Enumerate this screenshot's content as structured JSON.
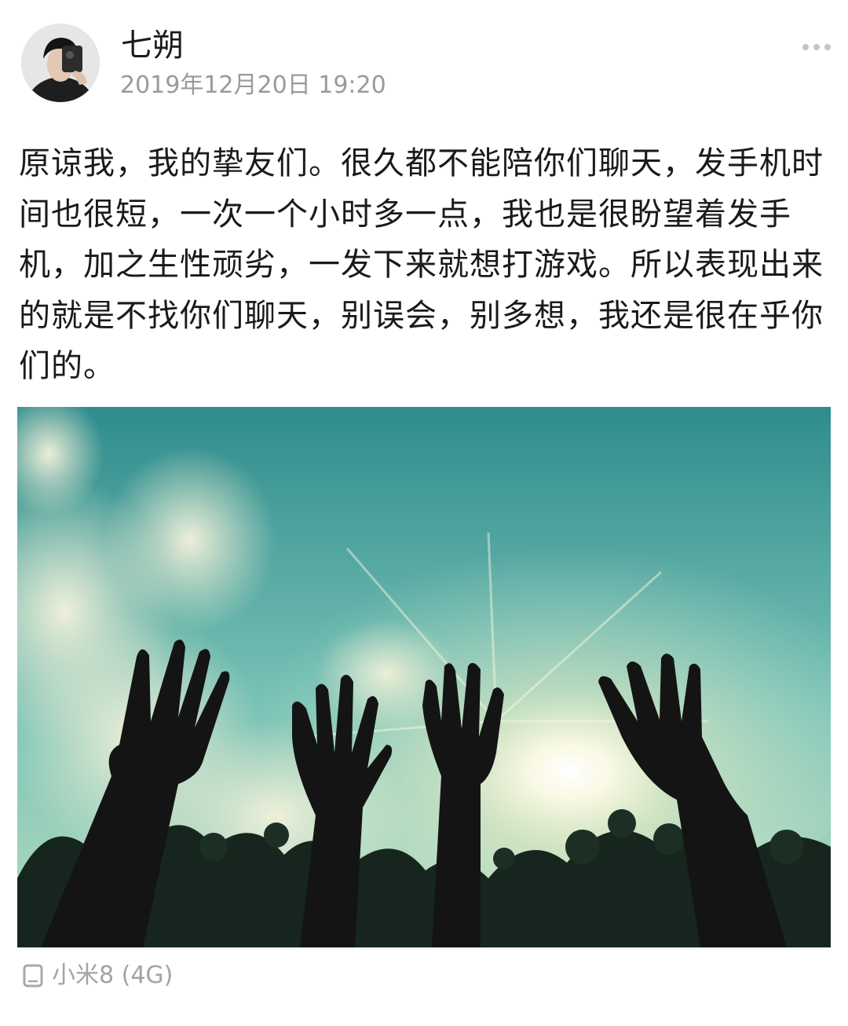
{
  "post": {
    "author": "七朔",
    "timestamp": "2019年12月20日 19:20",
    "text": "原谅我，我的挚友们。很久都不能陪你们聊天，发手机时间也很短，一次一个小时多一点，我也是很盼望着发手机，加之生性顽劣，一发下来就想打游戏。所以表现出来的就是不找你们聊天，别误会，别多想，我还是很在乎你们的。",
    "device": "小米8 (4G)"
  },
  "icons": {
    "more": "more-dots-icon",
    "device": "phone-icon"
  },
  "colors": {
    "text": "#1a1a1a",
    "secondary": "#9a9a9a",
    "more_dots": "#c4c4c4",
    "sky": "#5fb2ac"
  }
}
